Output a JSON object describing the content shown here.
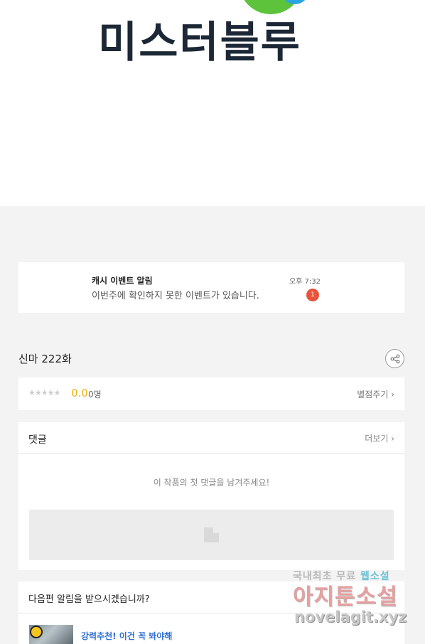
{
  "logo": {
    "text": "미스터블루"
  },
  "notification": {
    "title": "캐시 이벤트 알림",
    "message": "이번주에 확인하지 못한 이벤트가 있습니다.",
    "time": "오후 7:32",
    "badge_count": "1"
  },
  "episode": {
    "title": "신마 222화"
  },
  "rating": {
    "stars": "★★★★★",
    "score": "0.0",
    "count": "0명",
    "rate_link": "별점주기 ›"
  },
  "comments": {
    "title": "댓글",
    "more": "더보기 ›",
    "empty_message": "이 작품의 첫 댓글을 남겨주세요!"
  },
  "next_episode": {
    "question": "다음편 알림을 받으시겠습니까?",
    "recommend_link": "강력추천! 이건 꼭 봐야해"
  },
  "watermark": {
    "line1_a": "국내최초 무료 ",
    "line1_b": "웹소설",
    "line2": "아지툰소설",
    "line3": "novelagit.xyz"
  },
  "colors": {
    "accent_star": "#f2b21b",
    "badge": "#e8533b",
    "link": "#2e6fd6"
  }
}
